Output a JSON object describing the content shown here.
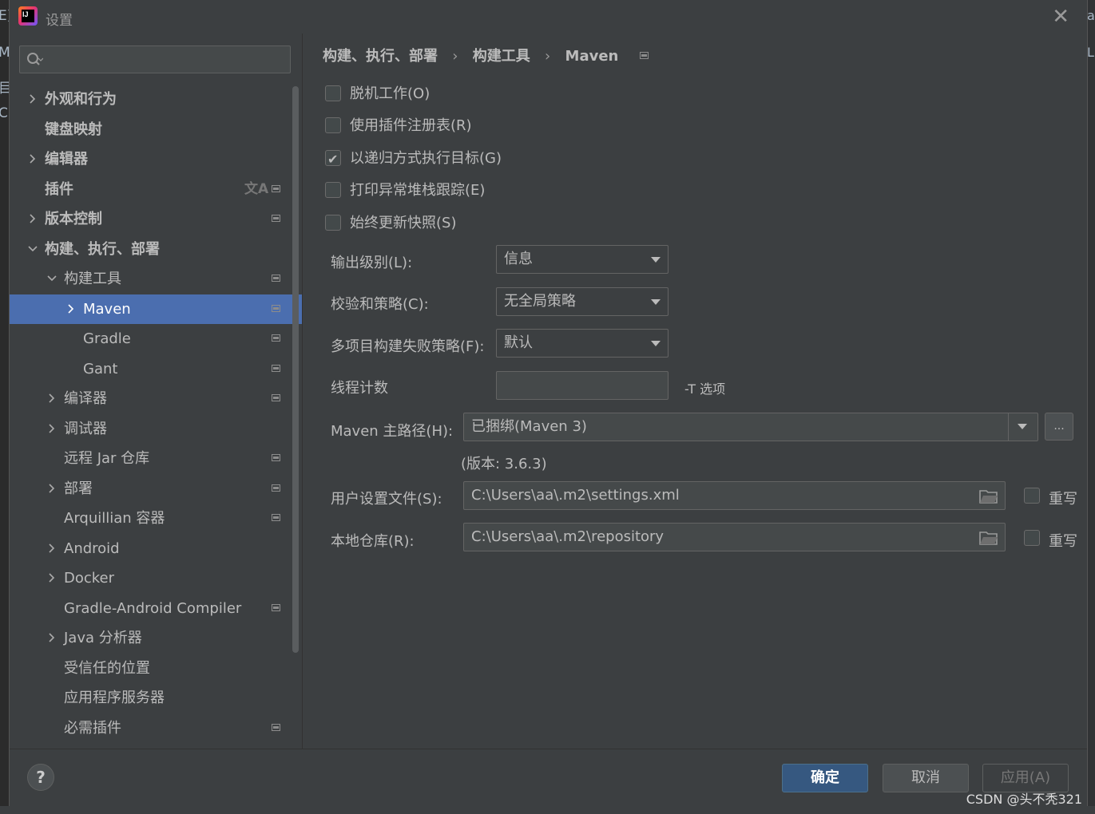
{
  "window": {
    "title": "设置"
  },
  "search": {
    "placeholder": ""
  },
  "tree": [
    {
      "label": "外观和行为",
      "bold": true,
      "chevron": "right",
      "indent": 0
    },
    {
      "label": "键盘映射",
      "bold": true,
      "chevron": "",
      "indent": 0
    },
    {
      "label": "编辑器",
      "bold": true,
      "chevron": "right",
      "indent": 0
    },
    {
      "label": "插件",
      "bold": true,
      "chevron": "",
      "indent": 0,
      "translate_icon": "文A",
      "project_icon": true
    },
    {
      "label": "版本控制",
      "bold": true,
      "chevron": "right",
      "indent": 0,
      "project_icon": true
    },
    {
      "label": "构建、执行、部署",
      "bold": true,
      "chevron": "down",
      "indent": 0
    },
    {
      "label": "构建工具",
      "bold": false,
      "chevron": "down",
      "indent": 1,
      "project_icon": true
    },
    {
      "label": "Maven",
      "bold": false,
      "chevron": "right",
      "indent": 2,
      "project_icon": true,
      "selected": true
    },
    {
      "label": "Gradle",
      "bold": false,
      "chevron": "",
      "indent": 2,
      "project_icon": true
    },
    {
      "label": "Gant",
      "bold": false,
      "chevron": "",
      "indent": 2,
      "project_icon": true
    },
    {
      "label": "编译器",
      "bold": false,
      "chevron": "right",
      "indent": 1,
      "project_icon": true
    },
    {
      "label": "调试器",
      "bold": false,
      "chevron": "right",
      "indent": 1
    },
    {
      "label": "远程 Jar 仓库",
      "bold": false,
      "chevron": "",
      "indent": 1,
      "project_icon": true
    },
    {
      "label": "部署",
      "bold": false,
      "chevron": "right",
      "indent": 1,
      "project_icon": true
    },
    {
      "label": "Arquillian 容器",
      "bold": false,
      "chevron": "",
      "indent": 1,
      "project_icon": true
    },
    {
      "label": "Android",
      "bold": false,
      "chevron": "right",
      "indent": 1
    },
    {
      "label": "Docker",
      "bold": false,
      "chevron": "right",
      "indent": 1
    },
    {
      "label": "Gradle-Android Compiler",
      "bold": false,
      "chevron": "",
      "indent": 1,
      "project_icon": true
    },
    {
      "label": "Java 分析器",
      "bold": false,
      "chevron": "right",
      "indent": 1
    },
    {
      "label": "受信任的位置",
      "bold": false,
      "chevron": "",
      "indent": 1
    },
    {
      "label": "应用程序服务器",
      "bold": false,
      "chevron": "",
      "indent": 1
    },
    {
      "label": "必需插件",
      "bold": false,
      "chevron": "",
      "indent": 1,
      "project_icon": true
    }
  ],
  "breadcrumb": {
    "items": [
      "构建、执行、部署",
      "构建工具",
      "Maven"
    ],
    "separator": "›"
  },
  "checkboxes": [
    {
      "label": "脱机工作(O)",
      "checked": false
    },
    {
      "label": "使用插件注册表(R)",
      "checked": false
    },
    {
      "label": "以递归方式执行目标(G)",
      "checked": true
    },
    {
      "label": "打印异常堆栈跟踪(E)",
      "checked": false
    },
    {
      "label": "始终更新快照(S)",
      "checked": false
    }
  ],
  "fields": {
    "output_level": {
      "label": "输出级别(L):",
      "value": "信息"
    },
    "checksum_policy": {
      "label": "校验和策略(C):",
      "value": "无全局策略"
    },
    "multiproject_fail": {
      "label": "多项目构建失败策略(F):",
      "value": "默认"
    },
    "thread_count": {
      "label": "线程计数",
      "value": "",
      "hint": "-T 选项"
    },
    "maven_home": {
      "label": "Maven 主路径(H):",
      "value": "已捆绑(Maven 3)",
      "browse": "...",
      "version": "(版本: 3.6.3)"
    },
    "user_settings": {
      "label": "用户设置文件(S):",
      "value": "C:\\Users\\aa\\.m2\\settings.xml",
      "override": "重写"
    },
    "local_repo": {
      "label": "本地仓库(R):",
      "value": "C:\\Users\\aa\\.m2\\repository",
      "override": "重写"
    }
  },
  "footer": {
    "help": "?",
    "ok": "确定",
    "cancel": "取消",
    "apply": "应用(A)"
  },
  "watermark": "CSDN @头不秃321",
  "colors": {
    "dialog_bg": "#3c3f41",
    "selection": "#4b6eaf",
    "primary_button": "#365880"
  }
}
